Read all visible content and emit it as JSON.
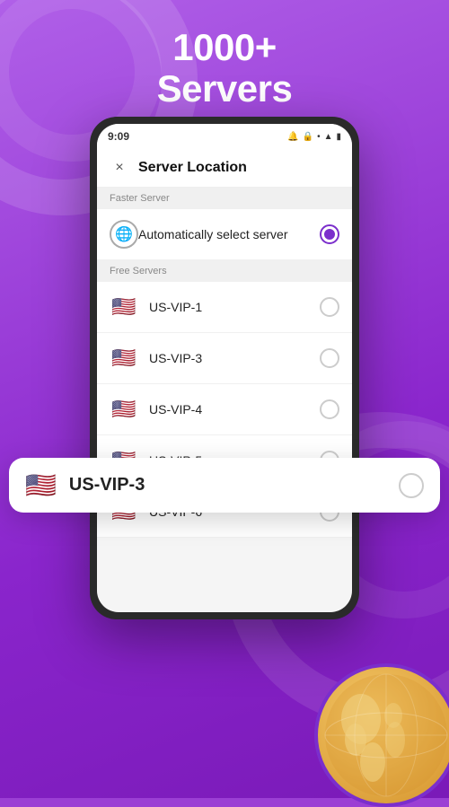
{
  "hero": {
    "line1": "1000+",
    "line2": "Servers"
  },
  "phone": {
    "status": {
      "time": "9:09",
      "icons": [
        "📶",
        "🔋"
      ]
    },
    "header": {
      "close_label": "×",
      "title": "Server Location"
    },
    "sections": [
      {
        "label": "Faster Server",
        "items": [
          {
            "id": "auto",
            "name": "Automatically select server",
            "selected": true,
            "type": "auto"
          }
        ]
      },
      {
        "label": "Free Servers",
        "items": [
          {
            "id": "us-vip-1",
            "name": "US-VIP-1",
            "selected": false,
            "type": "flag"
          },
          {
            "id": "us-vip-3b",
            "name": "US-VIP-3",
            "selected": false,
            "type": "flag"
          },
          {
            "id": "us-vip-4",
            "name": "US-VIP-4",
            "selected": false,
            "type": "flag"
          },
          {
            "id": "us-vip-5",
            "name": "US-VIP-5",
            "selected": false,
            "type": "flag"
          },
          {
            "id": "us-vip-6",
            "name": "US-VIP-6",
            "selected": false,
            "type": "flag"
          }
        ]
      }
    ]
  },
  "floating_item": {
    "name": "US-VIP-3",
    "flag": "🇺🇸",
    "selected": false
  },
  "icons": {
    "close": "×",
    "globe": "🌐",
    "wifi": "▲",
    "battery": "▮"
  }
}
